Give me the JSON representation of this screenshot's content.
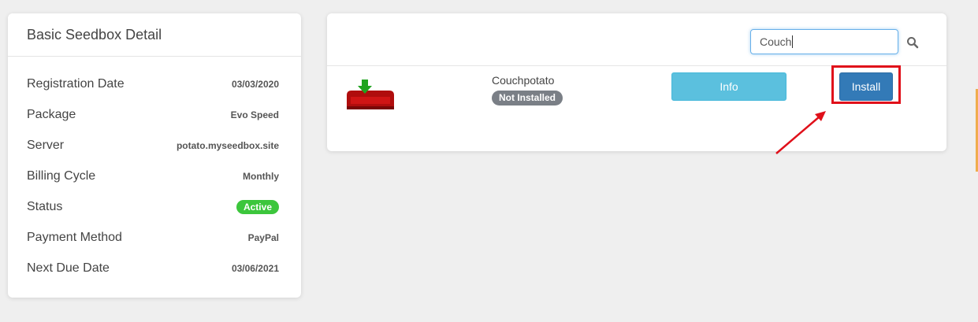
{
  "detail": {
    "title": "Basic Seedbox Detail",
    "rows": [
      {
        "label": "Registration Date",
        "value": "03/03/2020"
      },
      {
        "label": "Package",
        "value": "Evo Speed"
      },
      {
        "label": "Server",
        "value": "potato.myseedbox.site"
      },
      {
        "label": "Billing Cycle",
        "value": "Monthly"
      },
      {
        "label": "Status",
        "value": "Active"
      },
      {
        "label": "Payment Method",
        "value": "PayPal"
      },
      {
        "label": "Next Due Date",
        "value": "03/06/2021"
      }
    ]
  },
  "apps": {
    "search": {
      "value": "Couch",
      "icon": "search-icon"
    },
    "item": {
      "name": "Couchpotato",
      "status": "Not Installed",
      "logo": "couchpotato-logo",
      "info_label": "Info",
      "install_label": "Install"
    }
  },
  "colors": {
    "active": "#3cc63c",
    "not_installed": "#7a7f86",
    "info": "#5bc0de",
    "install": "#337ab7",
    "annotation": "#e0101a"
  }
}
